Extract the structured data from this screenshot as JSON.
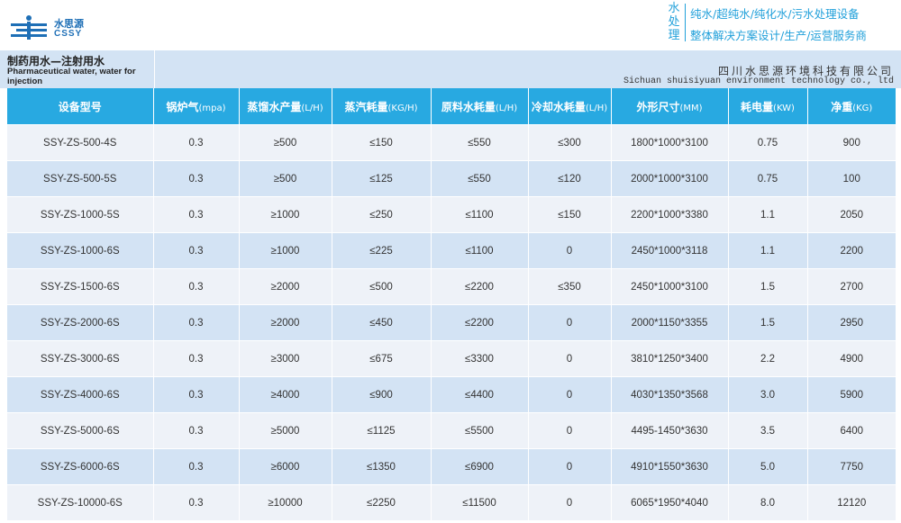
{
  "brand": {
    "name_cn": "水思源",
    "name_en": "CSSY"
  },
  "tagline": {
    "vertical_chars": [
      "水",
      "处",
      "理"
    ],
    "line1": "纯水/超纯水/纯化水/污水处理设备",
    "line2": "整体解决方案设计/生产/运营服务商"
  },
  "product": {
    "title_cn": "制药用水—注射用水",
    "title_en": "Pharmaceutical water, water for injection"
  },
  "company": {
    "name_cn": "四川水思源环境科技有限公司",
    "name_en": "Sichuan shuisiyuan environment technology co., ltd"
  },
  "colors": {
    "header_blue": "#28a9e1",
    "band_blue": "#d3e3f4",
    "row_light": "#eef2f8",
    "accent": "#21a0da"
  },
  "table": {
    "headers": [
      {
        "main": "设备型号",
        "unit": ""
      },
      {
        "main": "锅炉气",
        "unit": "(mpa)"
      },
      {
        "main": "蒸馏水产量",
        "unit": "(L/H)"
      },
      {
        "main": "蒸汽耗量",
        "unit": "(KG/H)"
      },
      {
        "main": "原料水耗量",
        "unit": "(L/H)"
      },
      {
        "main": "冷却水耗量",
        "unit": "(L/H)"
      },
      {
        "main": "外形尺寸",
        "unit": "(MM)"
      },
      {
        "main": "耗电量",
        "unit": "(KW)"
      },
      {
        "main": "净重",
        "unit": "(KG)"
      }
    ],
    "rows": [
      [
        "SSY-ZS-500-4S",
        "0.3",
        "≥500",
        "≤150",
        "≤550",
        "≤300",
        "1800*1000*3100",
        "0.75",
        "900"
      ],
      [
        "SSY-ZS-500-5S",
        "0.3",
        "≥500",
        "≤125",
        "≤550",
        "≤120",
        "2000*1000*3100",
        "0.75",
        "100"
      ],
      [
        "SSY-ZS-1000-5S",
        "0.3",
        "≥1000",
        "≤250",
        "≤1100",
        "≤150",
        "2200*1000*3380",
        "1.1",
        "2050"
      ],
      [
        "SSY-ZS-1000-6S",
        "0.3",
        "≥1000",
        "≤225",
        "≤1100",
        "0",
        "2450*1000*3118",
        "1.1",
        "2200"
      ],
      [
        "SSY-ZS-1500-6S",
        "0.3",
        "≥2000",
        "≤500",
        "≤2200",
        "≤350",
        "2450*1000*3100",
        "1.5",
        "2700"
      ],
      [
        "SSY-ZS-2000-6S",
        "0.3",
        "≥2000",
        "≤450",
        "≤2200",
        "0",
        "2000*1150*3355",
        "1.5",
        "2950"
      ],
      [
        "SSY-ZS-3000-6S",
        "0.3",
        "≥3000",
        "≤675",
        "≤3300",
        "0",
        "3810*1250*3400",
        "2.2",
        "4900"
      ],
      [
        "SSY-ZS-4000-6S",
        "0.3",
        "≥4000",
        "≤900",
        "≤4400",
        "0",
        "4030*1350*3568",
        "3.0",
        "5900"
      ],
      [
        "SSY-ZS-5000-6S",
        "0.3",
        "≥5000",
        "≤1125",
        "≤5500",
        "0",
        "4495-1450*3630",
        "3.5",
        "6400"
      ],
      [
        "SSY-ZS-6000-6S",
        "0.3",
        "≥6000",
        "≤1350",
        "≤6900",
        "0",
        "4910*1550*3630",
        "5.0",
        "7750"
      ],
      [
        "SSY-ZS-10000-6S",
        "0.3",
        "≥10000",
        "≤2250",
        "≤11500",
        "0",
        "6065*1950*4040",
        "8.0",
        "12120"
      ]
    ]
  }
}
